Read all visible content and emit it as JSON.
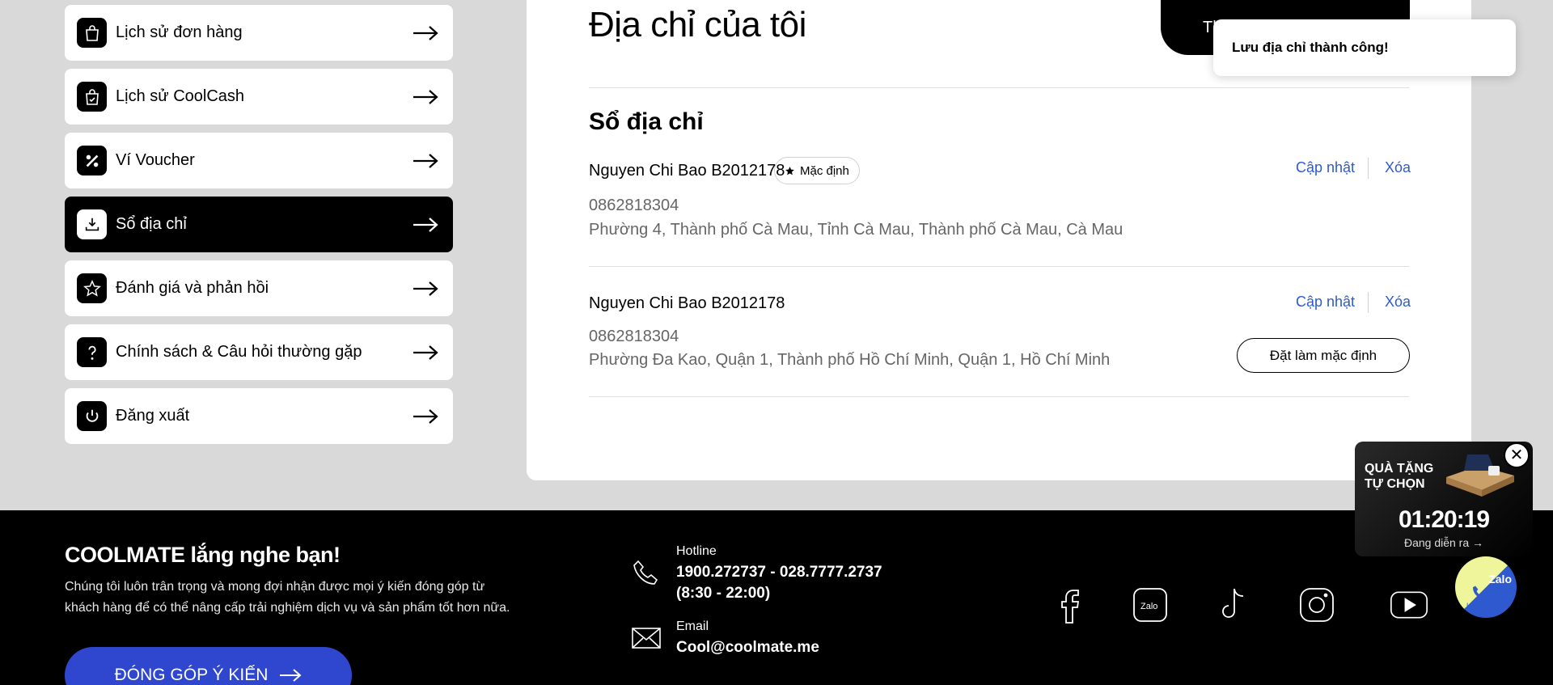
{
  "sidebar": {
    "items": [
      {
        "label": "Lịch sử đơn hàng",
        "icon": "shopping-bag-icon",
        "active": false
      },
      {
        "label": "Lịch sử CoolCash",
        "icon": "cash-bag-icon",
        "active": false
      },
      {
        "label": "Ví Voucher",
        "icon": "percent-icon",
        "active": false
      },
      {
        "label": "Sổ địa chỉ",
        "icon": "address-book-icon",
        "active": true
      },
      {
        "label": "Đánh giá và phản hồi",
        "icon": "star-icon",
        "active": false
      },
      {
        "label": "Chính sách & Câu hỏi thường gặp",
        "icon": "question-icon",
        "active": false
      },
      {
        "label": "Đăng xuất",
        "icon": "power-icon",
        "active": false
      }
    ]
  },
  "main": {
    "title": "Địa chỉ của tôi",
    "add_button_label": "Thêm địa chỉ mới",
    "section_title": "Sổ địa chỉ",
    "addresses": [
      {
        "name": "Nguyen Chi Bao B2012178",
        "is_default": true,
        "default_label": "Mặc định",
        "phone": "0862818304",
        "address": "Phường 4, Thành phố Cà Mau, Tỉnh Cà Mau, Thành phố Cà Mau, Cà Mau"
      },
      {
        "name": "Nguyen Chi Bao B2012178",
        "is_default": false,
        "phone": "0862818304",
        "address": "Phường Đa Kao, Quận 1, Thành phố Hồ Chí Minh, Quận 1, Hồ Chí Minh"
      }
    ],
    "update_label": "Cập nhật",
    "delete_label": "Xóa",
    "set_default_label": "Đặt làm mặc định"
  },
  "toast": {
    "message": "Lưu địa chỉ thành công!"
  },
  "footer": {
    "title": "COOLMATE lắng nghe bạn!",
    "description": "Chúng tôi luôn trân trọng và mong đợi nhận được mọi ý kiến đóng góp từ khách hàng để có thể nâng cấp trải nghiệm dịch vụ và sản phẩm tốt hơn nữa.",
    "cta_label": "ĐÓNG GÓP Ý KIẾN",
    "hotline_label": "Hotline",
    "hotline_value": "1900.272737 - 028.7777.2737",
    "hotline_hours": "(8:30 - 22:00)",
    "email_label": "Email",
    "email_value": "Cool@coolmate.me",
    "socials": [
      "facebook-icon",
      "zalo-icon",
      "tiktok-icon",
      "instagram-icon",
      "youtube-icon"
    ],
    "zalo_social_text": "Zalo"
  },
  "promo": {
    "title": "QUÀ TẶNG TỰ CHỌN",
    "timer": "01:20:19",
    "status": "Đang diễn ra →"
  },
  "floating": {
    "zalo_label": "Zalo",
    "hotline_label": "Hotline"
  },
  "colors": {
    "accent_blue": "#2f5acf",
    "cta_blue": "#2f46cf",
    "background": "#d9d9d9"
  }
}
